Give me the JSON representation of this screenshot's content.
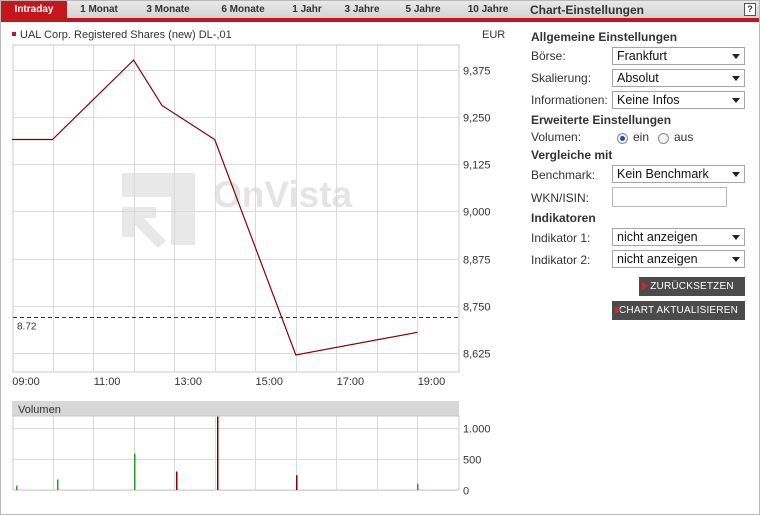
{
  "tabs": [
    {
      "label": "Intraday",
      "active": true
    },
    {
      "label": "1 Monat",
      "active": false
    },
    {
      "label": "3 Monate",
      "active": false
    },
    {
      "label": "6 Monate",
      "active": false
    },
    {
      "label": "1 Jahr",
      "active": false
    },
    {
      "label": "3 Jahre",
      "active": false
    },
    {
      "label": "5 Jahre",
      "active": false
    },
    {
      "label": "10 Jahre",
      "active": false
    }
  ],
  "settings": {
    "title": "Chart-Einstellungen",
    "help": "?",
    "general_title": "Allgemeine Einstellungen",
    "boerse_label": "Börse:",
    "boerse_value": "Frankfurt",
    "skalierung_label": "Skalierung:",
    "skalierung_value": "Absolut",
    "informationen_label": "Informationen:",
    "informationen_value": "Keine Infos",
    "extended_title": "Erweiterte Einstellungen",
    "volumen_label": "Volumen:",
    "volumen_on_label": "ein",
    "volumen_off_label": "aus",
    "volumen_selected": "ein",
    "compare_title": "Vergleiche mit",
    "benchmark_label": "Benchmark:",
    "benchmark_value": "Kein Benchmark",
    "wkn_label": "WKN/ISIN:",
    "wkn_value": "",
    "indicators_title": "Indikatoren",
    "indikator1_label": "Indikator 1:",
    "indikator1_value": "nicht anzeigen",
    "indikator2_label": "Indikator 2:",
    "indikator2_value": "nicht anzeigen",
    "reset_button": "ZURÜCKSETZEN",
    "update_button": "CHART AKTUALISIEREN"
  },
  "chart_data": [
    {
      "type": "line",
      "title": "UAL Corp. Registered Shares (new) DL-,01",
      "unit": "EUR",
      "watermark": "OnVista",
      "x_tick_labels": [
        "09:00",
        "11:00",
        "13:00",
        "15:00",
        "17:00",
        "19:00"
      ],
      "y_tick_labels": [
        "9,375",
        "9,250",
        "9,125",
        "9,000",
        "8,875",
        "8,750",
        "8,625"
      ],
      "y_ticks": [
        9.375,
        9.25,
        9.125,
        9.0,
        8.875,
        8.75,
        8.625
      ],
      "xlim": [
        9.0,
        20.0
      ],
      "ylim": [
        8.575,
        9.44
      ],
      "grid": true,
      "series": [
        {
          "color": "#8b0000",
          "x": [
            9.0,
            10.0,
            12.0,
            12.7,
            14.0,
            16.0,
            19.0
          ],
          "y": [
            9.19,
            9.19,
            9.4,
            9.28,
            9.19,
            8.62,
            8.68
          ]
        }
      ],
      "reference_line": {
        "value": 8.72,
        "label": "8.72",
        "style": "dashed"
      }
    },
    {
      "type": "bar",
      "title": "Volumen",
      "y_tick_labels": [
        "1.000",
        "500",
        "0"
      ],
      "y_ticks": [
        1000,
        500,
        0
      ],
      "ylim": [
        0,
        1200
      ],
      "xlim": [
        9.0,
        20.0
      ],
      "bars": [
        {
          "x": 9.1,
          "value": 70,
          "color": "#22a022"
        },
        {
          "x": 10.1,
          "value": 170,
          "color": "#22a022"
        },
        {
          "x": 12.0,
          "value": 590,
          "color": "#22a022"
        },
        {
          "x": 13.05,
          "value": 300,
          "color": "#8b0000"
        },
        {
          "x": 14.05,
          "value": 1190,
          "color": "#8b0000"
        },
        {
          "x": 16.0,
          "value": 240,
          "color": "#8b0000"
        },
        {
          "x": 19.0,
          "value": 100,
          "color": "#22a022"
        }
      ]
    }
  ]
}
